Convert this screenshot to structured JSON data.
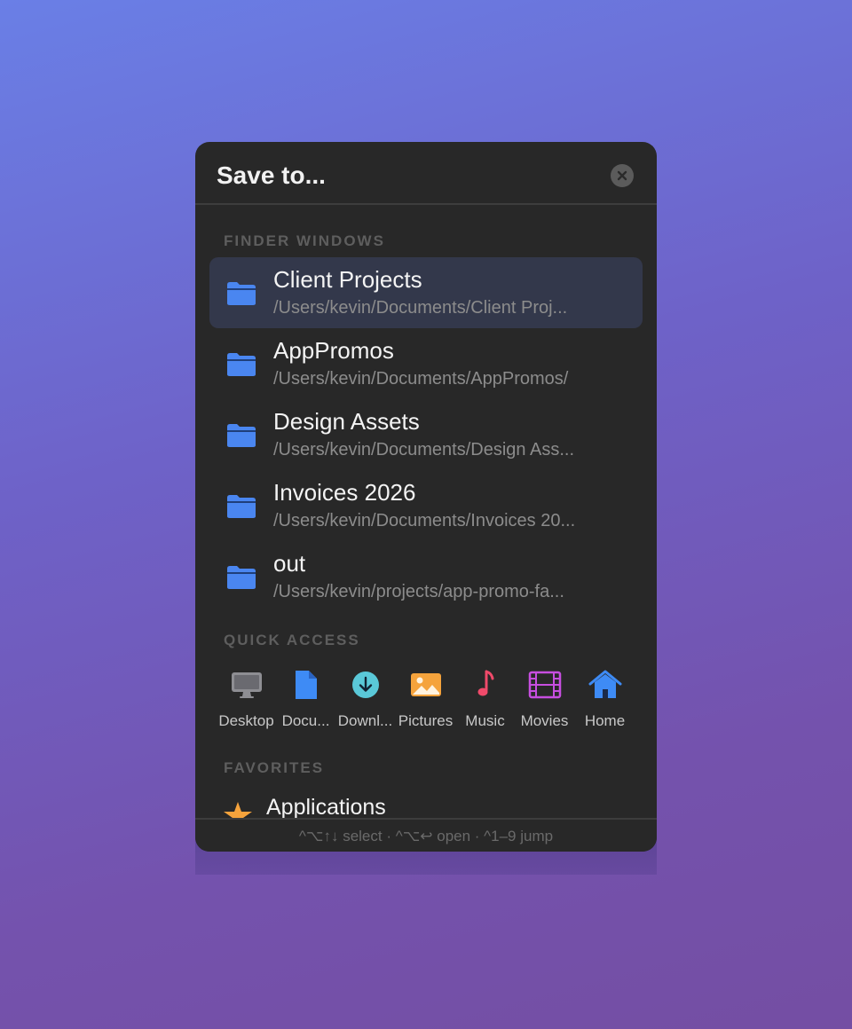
{
  "dialog": {
    "title": "Save to..."
  },
  "finder_windows": {
    "label": "FINDER WINDOWS",
    "items": [
      {
        "name": "Client Projects",
        "path": "/Users/kevin/Documents/Client Proj...",
        "selected": true
      },
      {
        "name": "AppPromos",
        "path": "/Users/kevin/Documents/AppPromos/",
        "selected": false
      },
      {
        "name": "Design Assets",
        "path": "/Users/kevin/Documents/Design Ass...",
        "selected": false
      },
      {
        "name": "Invoices 2026",
        "path": "/Users/kevin/Documents/Invoices 20...",
        "selected": false
      },
      {
        "name": "out",
        "path": "/Users/kevin/projects/app-promo-fa...",
        "selected": false
      }
    ]
  },
  "quick_access": {
    "label": "QUICK ACCESS",
    "items": [
      {
        "label": "Desktop",
        "icon": "desktop-icon",
        "color": "#8e8e93"
      },
      {
        "label": "Docu...",
        "icon": "document-icon",
        "color": "#3e8bf5"
      },
      {
        "label": "Downl...",
        "icon": "download-icon",
        "color": "#5ac8d8"
      },
      {
        "label": "Pictures",
        "icon": "picture-icon",
        "color": "#f5a33c"
      },
      {
        "label": "Music",
        "icon": "music-icon",
        "color": "#f04a6a"
      },
      {
        "label": "Movies",
        "icon": "film-icon",
        "color": "#c74ee0"
      },
      {
        "label": "Home",
        "icon": "home-icon",
        "color": "#3e8bf5"
      }
    ]
  },
  "favorites": {
    "label": "FAVORITES",
    "items": [
      {
        "name": "Applications",
        "icon": "applications-icon",
        "color": "#f5a33c"
      }
    ]
  },
  "footer": {
    "hint": "^⌥↑↓ select · ^⌥↩ open · ^1–9 jump"
  },
  "colors": {
    "folder": "#4a86f0",
    "selected_row": "#33384b",
    "panel_bg": "#282828"
  }
}
